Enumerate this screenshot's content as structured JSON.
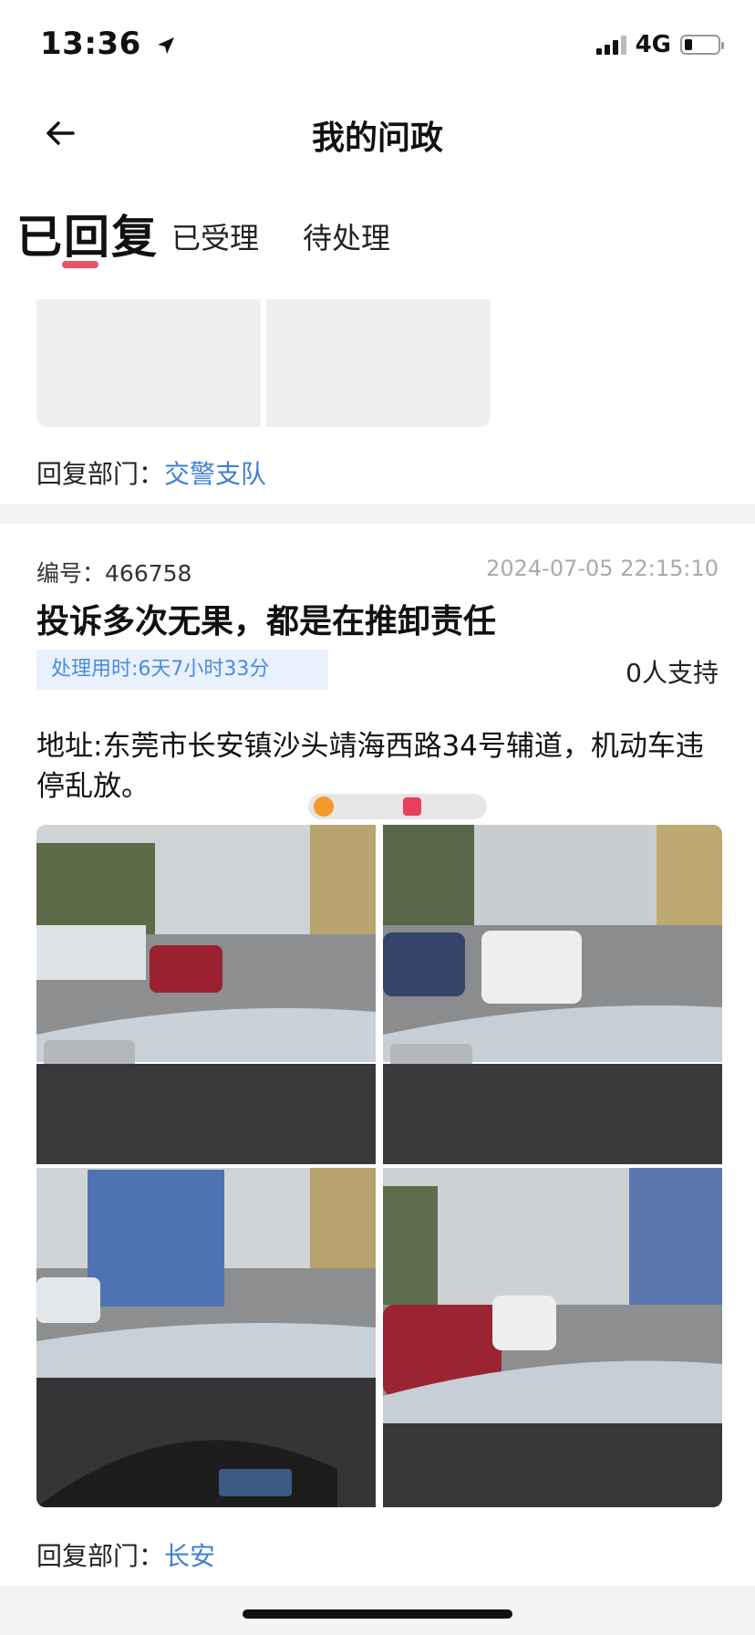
{
  "status_bar": {
    "time": "13:36",
    "network": "4G"
  },
  "header": {
    "title": "我的问政"
  },
  "tabs": [
    {
      "label": "已回复",
      "active": true
    },
    {
      "label": "已受理",
      "active": false
    },
    {
      "label": "待处理",
      "active": false
    }
  ],
  "previous_card": {
    "reply_dept_label": "回复部门：",
    "reply_dept_value": "交警支队"
  },
  "card": {
    "code_label": "编号：",
    "code_value": "466758",
    "datetime": "2024-07-05 22:15:10",
    "title": "投诉多次无果，都是在推卸责任",
    "processing_time": "处理用时:6天7小时33分",
    "support": "0人支持",
    "address": "地址:东莞市长安镇沙头靖海西路34号辅道，机动车违停乱放。",
    "photos": [
      "street-photo-1",
      "street-photo-2",
      "street-photo-3",
      "street-photo-4"
    ],
    "reply_dept_label": "回复部门：",
    "reply_dept_value": "长安"
  },
  "colors": {
    "accent_red": "#e85566",
    "link_blue": "#3f7fd6",
    "tag_bg": "#e9f1fd"
  },
  "icons": [
    "location-arrow-icon",
    "signal-icon",
    "battery-icon",
    "back-arrow-icon"
  ]
}
